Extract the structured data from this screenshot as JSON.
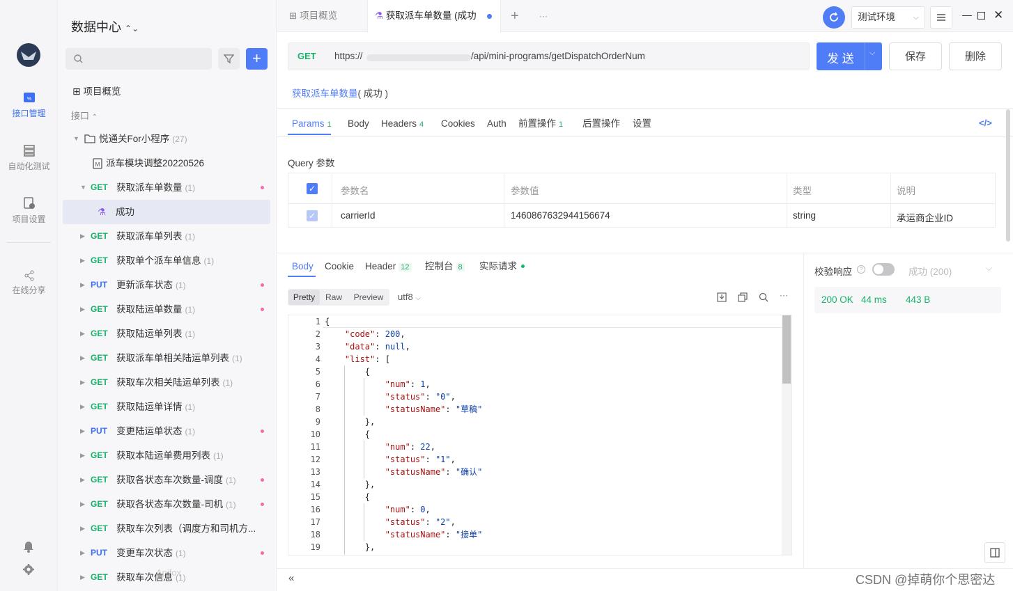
{
  "rail": {
    "items": [
      {
        "label": "接口管理",
        "icon": "api-icon",
        "active": true
      },
      {
        "label": "自动化测试",
        "icon": "flow-icon",
        "active": false
      },
      {
        "label": "项目设置",
        "icon": "project-settings-icon",
        "active": false
      },
      {
        "label": "在线分享",
        "icon": "share-icon",
        "active": false
      }
    ]
  },
  "sidebar": {
    "title": "数据中心",
    "overview": "项目概览",
    "section": "接口",
    "folder": {
      "name": "悦通关For小程序",
      "count": "(27)"
    },
    "doc": "派车模块调整20220526",
    "items": [
      {
        "method": "GET",
        "name": "获取派车单数量",
        "count": "(1)",
        "dot": true,
        "expanded": true
      },
      {
        "method": "GET",
        "name": "获取派车单列表",
        "count": "(1)",
        "dot": false
      },
      {
        "method": "GET",
        "name": "获取单个派车单信息",
        "count": "(1)",
        "dot": false
      },
      {
        "method": "PUT",
        "name": "更新派车状态",
        "count": "(1)",
        "dot": true
      },
      {
        "method": "GET",
        "name": "获取陆运单数量",
        "count": "(1)",
        "dot": true
      },
      {
        "method": "GET",
        "name": "获取陆运单列表",
        "count": "(1)",
        "dot": false
      },
      {
        "method": "GET",
        "name": "获取派车单相关陆运单列表",
        "count": "(1)",
        "dot": false
      },
      {
        "method": "GET",
        "name": "获取车次相关陆运单列表",
        "count": "(1)",
        "dot": false
      },
      {
        "method": "GET",
        "name": "获取陆运单详情",
        "count": "(1)",
        "dot": false
      },
      {
        "method": "PUT",
        "name": "变更陆运单状态",
        "count": "(1)",
        "dot": true
      },
      {
        "method": "GET",
        "name": "获取本陆运单费用列表",
        "count": "(1)",
        "dot": false
      },
      {
        "method": "GET",
        "name": "获取各状态车次数量-调度",
        "count": "(1)",
        "dot": true
      },
      {
        "method": "GET",
        "name": "获取各状态车次数量-司机",
        "count": "(1)",
        "dot": true
      },
      {
        "method": "GET",
        "name": "获取车次列表（调度方和司机方...",
        "count": "",
        "dot": false
      },
      {
        "method": "PUT",
        "name": "变更车次状态",
        "count": "(1)",
        "dot": true
      },
      {
        "method": "GET",
        "name": "获取车次信息",
        "count": "(1)",
        "dot": false
      }
    ],
    "child": "成功"
  },
  "tabs": {
    "overview": "项目概览",
    "active": "获取派车单数量 (成功",
    "add": "+",
    "more": "···"
  },
  "env": "测试环境",
  "request": {
    "method": "GET",
    "url_prefix": "https://",
    "url_suffix": "/api/mini-programs/getDispatchOrderNum",
    "send": "发 送",
    "save": "保存",
    "delete": "删除"
  },
  "breadcrumb": {
    "name": "获取派车单数量",
    "suffix": "( 成功 )"
  },
  "param_tabs": [
    {
      "label": "Params",
      "n": "1"
    },
    {
      "label": "Body",
      "n": ""
    },
    {
      "label": "Headers",
      "n": "4"
    },
    {
      "label": "Cookies",
      "n": ""
    },
    {
      "label": "Auth",
      "n": ""
    },
    {
      "label": "前置操作",
      "n": "1"
    },
    {
      "label": "后置操作",
      "n": ""
    },
    {
      "label": "设置",
      "n": ""
    }
  ],
  "query": {
    "title": "Query 参数",
    "headers": [
      "参数名",
      "参数值",
      "类型",
      "说明"
    ],
    "row": {
      "name": "carrierId",
      "value": "1460867632944156674",
      "type": "string",
      "desc": "承运商企业ID"
    }
  },
  "resp_tabs": [
    {
      "label": "Body",
      "n": ""
    },
    {
      "label": "Cookie",
      "n": ""
    },
    {
      "label": "Header",
      "n": "12"
    },
    {
      "label": "控制台",
      "n": "8"
    },
    {
      "label": "实际请求",
      "n": ""
    }
  ],
  "view": {
    "pretty": "Pretty",
    "raw": "Raw",
    "preview": "Preview",
    "enc": "utf8"
  },
  "validate": {
    "label": "校验响应",
    "status": "成功 (200)"
  },
  "stats": {
    "code": "200 OK",
    "time": "44 ms",
    "size": "443 B"
  },
  "code_lines": [
    "{",
    "    \"code\": 200,",
    "    \"data\": null,",
    "    \"list\": [",
    "        {",
    "            \"num\": 1,",
    "            \"status\": \"0\",",
    "            \"statusName\": \"草稿\"",
    "        },",
    "        {",
    "            \"num\": 22,",
    "            \"status\": \"1\",",
    "            \"statusName\": \"确认\"",
    "        },",
    "        {",
    "            \"num\": 0,",
    "            \"status\": \"2\",",
    "            \"statusName\": \"接单\"",
    "        },"
  ],
  "watermark": "CSDN @掉萌你个思密达",
  "footer": "Apifox"
}
